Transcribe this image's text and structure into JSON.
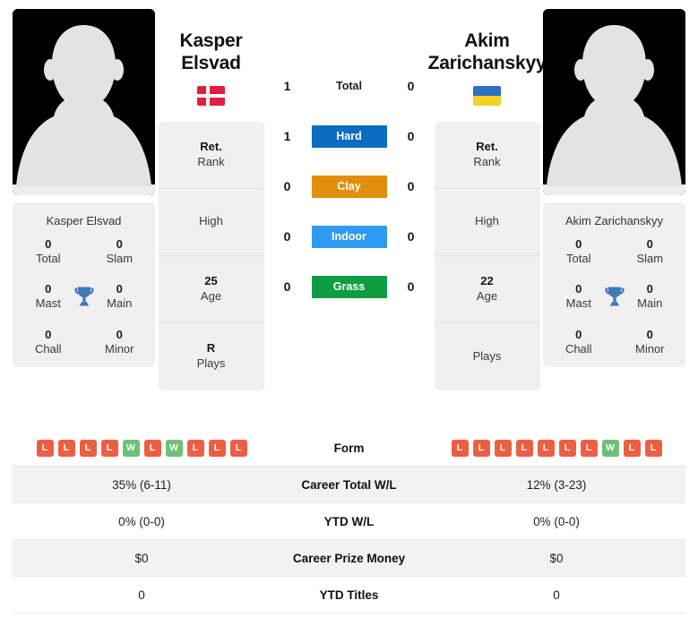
{
  "players": {
    "left": {
      "first_name": "Kasper",
      "last_name": "Elsvad",
      "full_name": "Kasper Elsvad",
      "flag_name": "denmark-flag",
      "flag_colors": [
        "#e01e40",
        "#ffffff"
      ],
      "titles": {
        "total": "0",
        "total_label": "Total",
        "slam": "0",
        "slam_label": "Slam",
        "mast": "0",
        "mast_label": "Mast",
        "main": "0",
        "main_label": "Main",
        "chall": "0",
        "chall_label": "Chall",
        "minor": "0",
        "minor_label": "Minor"
      },
      "vitals": [
        {
          "value": "Ret.",
          "label": "Rank"
        },
        {
          "value": "",
          "label": "High"
        },
        {
          "value": "25",
          "label": "Age"
        },
        {
          "value": "R",
          "label": "Plays"
        }
      ],
      "form": [
        "L",
        "L",
        "L",
        "L",
        "W",
        "L",
        "W",
        "L",
        "L",
        "L"
      ],
      "career_total_wl": "35% (6-11)",
      "ytd_wl": "0% (0-0)",
      "career_prize_money": "$0",
      "ytd_titles": "0"
    },
    "right": {
      "first_name": "Akim",
      "last_name": "Zarichanskyy",
      "full_name": "Akim Zarichanskyy",
      "flag_name": "ukraine-flag",
      "flag_colors": [
        "#2e6ec4",
        "#f5d020"
      ],
      "titles": {
        "total": "0",
        "total_label": "Total",
        "slam": "0",
        "slam_label": "Slam",
        "mast": "0",
        "mast_label": "Mast",
        "main": "0",
        "main_label": "Main",
        "chall": "0",
        "chall_label": "Chall",
        "minor": "0",
        "minor_label": "Minor"
      },
      "vitals": [
        {
          "value": "Ret.",
          "label": "Rank"
        },
        {
          "value": "",
          "label": "High"
        },
        {
          "value": "22",
          "label": "Age"
        },
        {
          "value": "",
          "label": "Plays"
        }
      ],
      "form": [
        "L",
        "L",
        "L",
        "L",
        "L",
        "L",
        "L",
        "W",
        "L",
        "L"
      ],
      "career_total_wl": "12% (3-23)",
      "ytd_wl": "0% (0-0)",
      "career_prize_money": "$0",
      "ytd_titles": "0"
    }
  },
  "h2h": [
    {
      "label": "Total",
      "left": "1",
      "right": "0",
      "color": "none",
      "style": "plain"
    },
    {
      "label": "Hard",
      "left": "1",
      "right": "0",
      "color": "#0a6dc2",
      "style": "badge"
    },
    {
      "label": "Clay",
      "left": "0",
      "right": "0",
      "color": "#e08e0b",
      "style": "badge"
    },
    {
      "label": "Indoor",
      "left": "0",
      "right": "0",
      "color": "#2e9bf0",
      "style": "badge"
    },
    {
      "label": "Grass",
      "left": "0",
      "right": "0",
      "color": "#0f9d42",
      "style": "badge"
    }
  ],
  "table_rows": [
    {
      "label": "Form",
      "type": "form"
    },
    {
      "label": "Career Total W/L",
      "type": "text",
      "key": "career_total_wl"
    },
    {
      "label": "YTD W/L",
      "type": "text",
      "key": "ytd_wl"
    },
    {
      "label": "Career Prize Money",
      "type": "text",
      "key": "career_prize_money"
    },
    {
      "label": "YTD Titles",
      "type": "text",
      "key": "ytd_titles"
    }
  ],
  "colors": {
    "win_badge": "#6ec177",
    "loss_badge": "#ec5f45",
    "trophy": "#4179b8",
    "card_bg": "#f0f0f0",
    "photo_bg": "#000000"
  }
}
